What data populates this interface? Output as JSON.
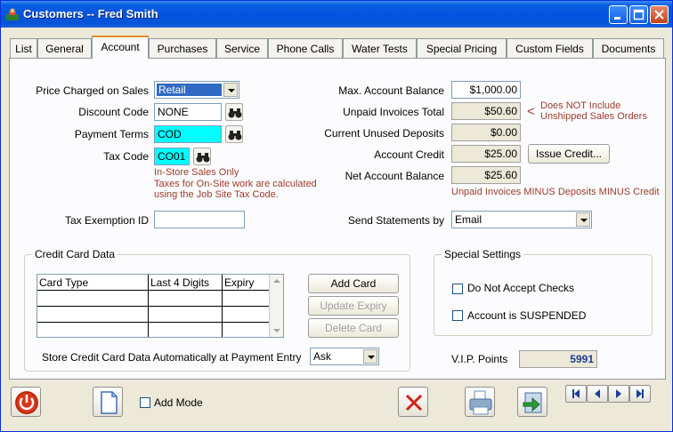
{
  "window": {
    "title": "Customers -- Fred Smith"
  },
  "tabs": [
    {
      "label": "List"
    },
    {
      "label": "General"
    },
    {
      "label": "Account"
    },
    {
      "label": "Purchases"
    },
    {
      "label": "Service"
    },
    {
      "label": "Phone Calls"
    },
    {
      "label": "Water Tests"
    },
    {
      "label": "Special Pricing"
    },
    {
      "label": "Custom Fields"
    },
    {
      "label": "Documents"
    }
  ],
  "account": {
    "price_label": "Price Charged on Sales",
    "price_value": "Retail",
    "discount_label": "Discount Code",
    "discount_value": "NONE",
    "terms_label": "Payment Terms",
    "terms_value": "COD",
    "tax_label": "Tax Code",
    "tax_value": "CO01",
    "tax_note1": "In-Store Sales Only",
    "tax_note2": "Taxes for On-Site work are calculated",
    "tax_note3": "using the Job Site Tax Code.",
    "exemption_label": "Tax Exemption ID",
    "exemption_value": "",
    "max_label": "Max. Account Balance",
    "max_value": "$1,000.00",
    "unpaid_label": "Unpaid Invoices Total",
    "unpaid_value": "$50.60",
    "unpaid_note_arrow": "<",
    "unpaid_note1": "Does NOT Include",
    "unpaid_note2": "Unshipped Sales Orders",
    "deposits_label": "Current Unused Deposits",
    "deposits_value": "$0.00",
    "credit_label": "Account Credit",
    "credit_value": "$25.00",
    "issue_credit_label": "Issue Credit...",
    "net_label": "Net Account Balance",
    "net_value": "$25.60",
    "net_note": "Unpaid Invoices MINUS Deposits MINUS Credit",
    "statements_label": "Send Statements by",
    "statements_value": "Email"
  },
  "credit_card": {
    "group_title": "Credit Card Data",
    "columns": [
      "Card Type",
      "Last 4 Digits",
      "Expiry"
    ],
    "add_label": "Add Card",
    "update_label": "Update Expiry",
    "delete_label": "Delete Card",
    "store_label": "Store Credit Card Data Automatically at Payment Entry",
    "store_value": "Ask"
  },
  "special": {
    "group_title": "Special Settings",
    "no_checks_label": "Do Not Accept Checks",
    "suspended_label": "Account is SUSPENDED"
  },
  "vip": {
    "label": "V.I.P. Points",
    "value": "5991"
  },
  "bottom": {
    "add_mode_label": "Add Mode"
  },
  "colors": {
    "accent_cyan": "#00ffff",
    "note_red": "#9b3b2a",
    "vip_blue": "#1c3c8c"
  }
}
